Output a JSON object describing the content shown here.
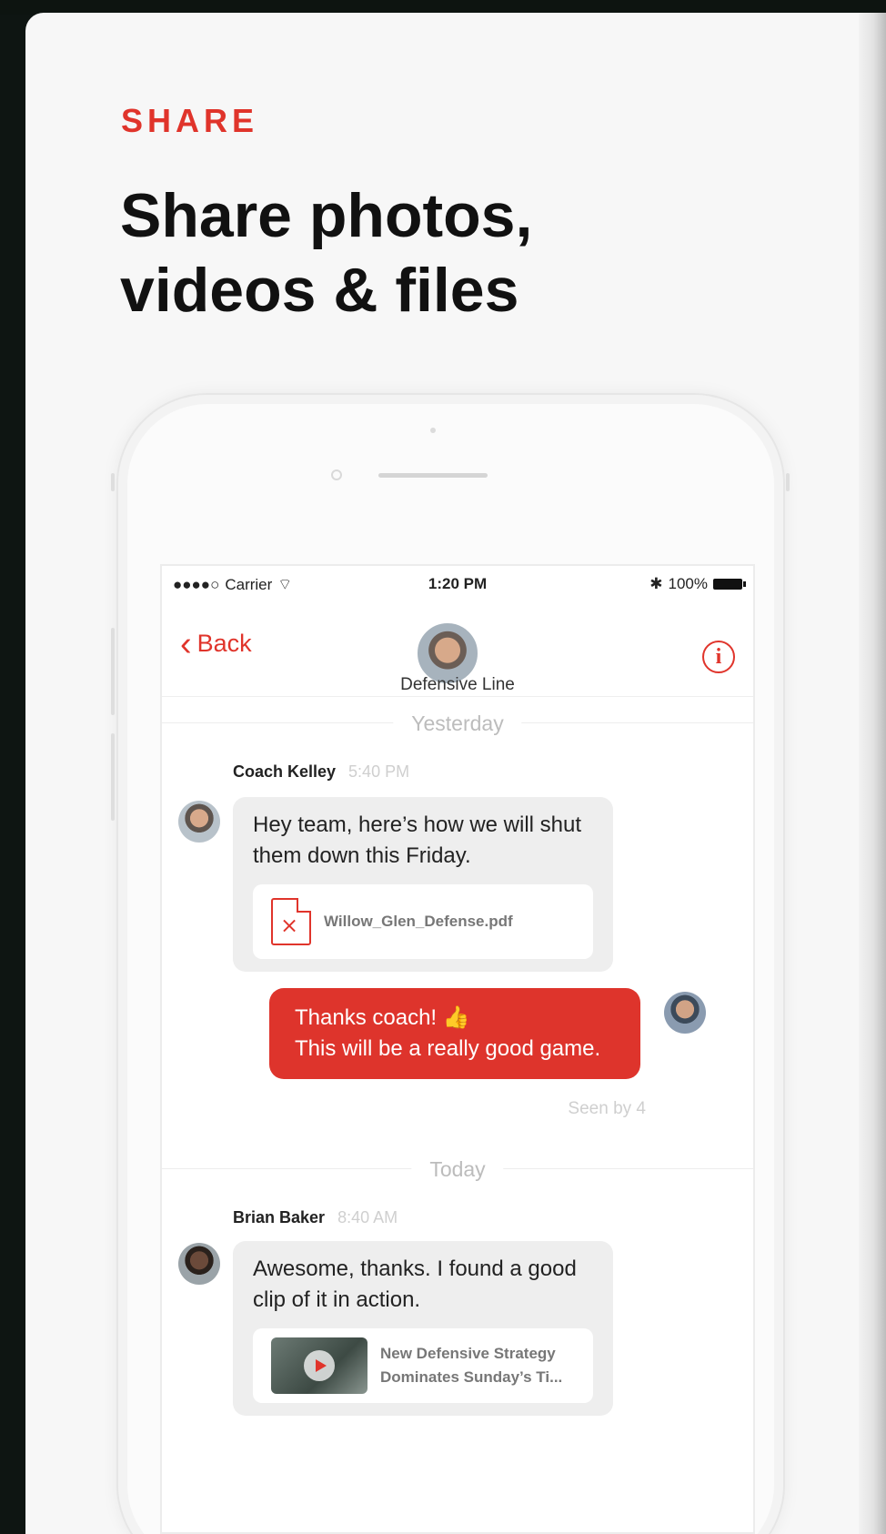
{
  "colors": {
    "accent": "#e0342b",
    "background": "#f7f7f7"
  },
  "eyebrow": "SHARE",
  "headline_line1": "Share photos,",
  "headline_line2": "videos & files",
  "status_bar": {
    "carrier": "Carrier",
    "time": "1:20 PM",
    "battery": "100%"
  },
  "nav": {
    "back": "Back",
    "title": "Defensive Line",
    "info_icon": "info-icon"
  },
  "messages": {
    "sep_yesterday": "Yesterday",
    "sep_today": "Today",
    "msg1": {
      "sender": "Coach Kelley",
      "time": "5:40 PM",
      "text": "Hey team, here’s how we will shut them down this Friday.",
      "attachment": "Willow_Glen_Defense.pdf"
    },
    "msg2": {
      "line1": "Thanks coach! 👍",
      "line2": "This will be a really good game.",
      "seen": "Seen by 4"
    },
    "msg3": {
      "sender": "Brian Baker",
      "time": "8:40 AM",
      "text": "Awesome, thanks. I found a good clip of it in action.",
      "link_line1": "New Defensive Strategy",
      "link_line2": "Dominates Sunday’s Ti..."
    }
  }
}
